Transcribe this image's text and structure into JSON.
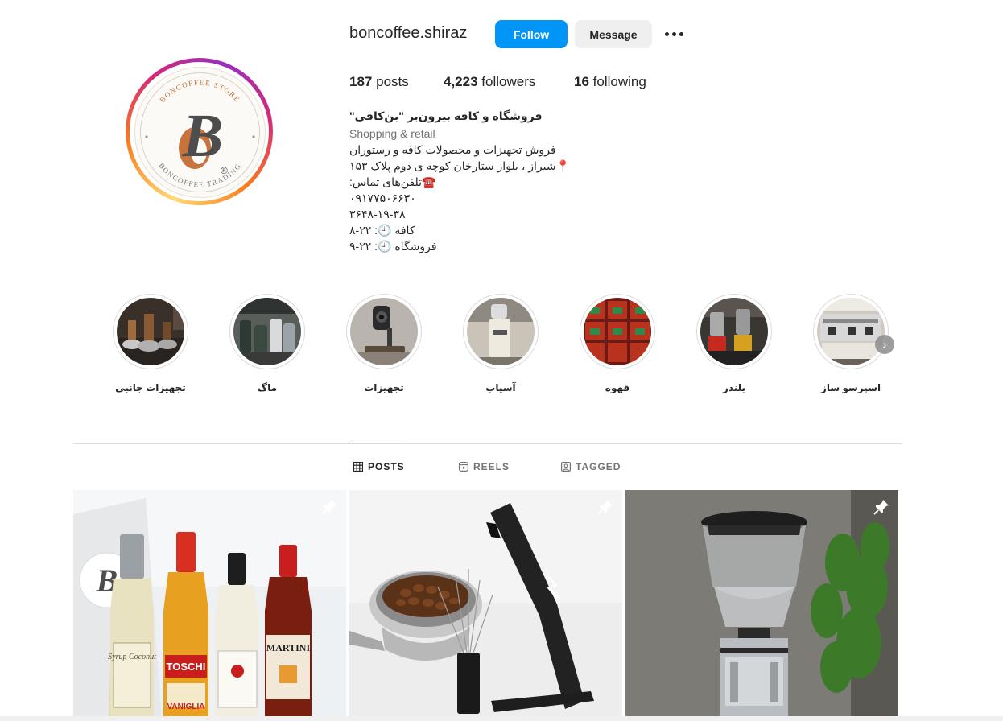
{
  "profile": {
    "username": "boncoffee.shiraz",
    "follow_label": "Follow",
    "message_label": "Message",
    "stats": {
      "posts_count": "187",
      "posts_label": "posts",
      "followers_count": "4,223",
      "followers_label": "followers",
      "following_count": "16",
      "following_label": "following"
    },
    "bio": {
      "name": "فروشگاه و کافه بیرون‌بر \"بن‌کافی\"",
      "category": "Shopping & retail",
      "lines": [
        "فروش تجهیزات و محصولات کافه و رستوران",
        "📍شیراز ، بلوار ستارخان کوچه ی دوم پلاک ۱۵۳",
        "☎️تلفن‌های تماس:",
        "۰۹۱۷۷۵۰۶۶۳۰",
        "۳۶۴۸-۱۹-۳۸",
        "کافه 🕘: ۲۲-۸",
        "فروشگاه 🕘: ۲۲-۹"
      ]
    },
    "avatar_text": {
      "top": "BONCOFFEE STORE",
      "bottom": "BONCOFFEE TRADING",
      "letter": "B",
      "registered": "®"
    }
  },
  "highlights": [
    {
      "label": "تجهیزات جانبی",
      "icon": "tampers-photo"
    },
    {
      "label": "ماگ",
      "icon": "mugs-photo"
    },
    {
      "label": "تجهیزات",
      "icon": "camera-equipment-photo"
    },
    {
      "label": "آسیاب",
      "icon": "grinder-photo"
    },
    {
      "label": "قهوه",
      "icon": "coffee-boxes-photo"
    },
    {
      "label": "بلندر",
      "icon": "blender-photo"
    },
    {
      "label": "اسپرسو ساز",
      "icon": "espresso-machine-photo"
    }
  ],
  "tabs": [
    {
      "label": "POSTS",
      "active": true,
      "icon": "grid-icon"
    },
    {
      "label": "REELS",
      "active": false,
      "icon": "reels-icon"
    },
    {
      "label": "TAGGED",
      "active": false,
      "icon": "tagged-icon"
    }
  ],
  "posts": [
    {
      "subject": "syrup bottles",
      "pinned": true,
      "bottle_labels": [
        "Syrup Coconut",
        "TOSCHI",
        "VANIGLIA",
        "MARTINI"
      ]
    },
    {
      "subject": "portafilter with coffee beans and distribution tool",
      "pinned": true
    },
    {
      "subject": "coffee grinder",
      "pinned": true
    }
  ],
  "colors": {
    "follow_blue": "#0095f6",
    "message_grey": "#efefef",
    "text_primary": "#262626",
    "text_secondary": "#737373",
    "brand_brown": "#c0703a"
  }
}
